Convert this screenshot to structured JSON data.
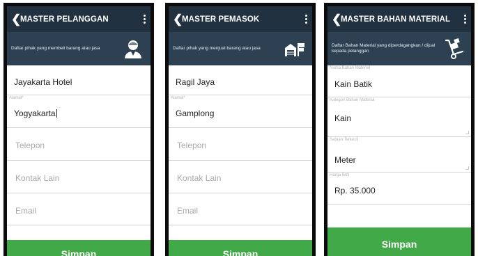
{
  "screens": [
    {
      "title": "MASTER PELANGGAN",
      "description": "Daftar pihak yang membeli barang atau jasa",
      "icon": "customer-icon",
      "fields": [
        {
          "label": "",
          "value": "Jayakarta Hotel",
          "placeholder": ""
        },
        {
          "label": "Alamat*",
          "value": "Yogyakarta",
          "placeholder": ""
        },
        {
          "label": "",
          "value": "",
          "placeholder": "Telepon"
        },
        {
          "label": "",
          "value": "",
          "placeholder": "Kontak Lain"
        },
        {
          "label": "",
          "value": "",
          "placeholder": "Email"
        }
      ],
      "save_label": "Simpan"
    },
    {
      "title": "MASTER PEMASOK",
      "description": "Daftar pihak yang menjual barang atau jasa",
      "icon": "supplier-icon",
      "fields": [
        {
          "label": "",
          "value": "Ragil Jaya",
          "placeholder": ""
        },
        {
          "label": "Alamat*",
          "value": "Gamplong",
          "placeholder": ""
        },
        {
          "label": "",
          "value": "",
          "placeholder": "Telepon"
        },
        {
          "label": "",
          "value": "",
          "placeholder": "Kontak Lain"
        },
        {
          "label": "",
          "value": "",
          "placeholder": "Email"
        }
      ],
      "save_label": "Simpan"
    },
    {
      "title": "MASTER BAHAN MATERIAL",
      "description": "Daftar Bahan Material yang diperdagangkan / dijual kepada pelanggan",
      "icon": "hand-truck-icon",
      "fields": [
        {
          "label": "Nama Bahan Material",
          "value": "Kain Batik",
          "placeholder": ""
        },
        {
          "label": "Kategori Bahan Material",
          "value": "Kain",
          "placeholder": ""
        },
        {
          "label": "Satuan Terkecil",
          "value": "Meter",
          "placeholder": ""
        },
        {
          "label": "Harga Beli",
          "value": "Rp. 35.000",
          "placeholder": ""
        }
      ],
      "save_label": "Simpan"
    }
  ],
  "colors": {
    "appbar": "#21313f",
    "banner": "#2e4152",
    "save": "#41a947"
  }
}
